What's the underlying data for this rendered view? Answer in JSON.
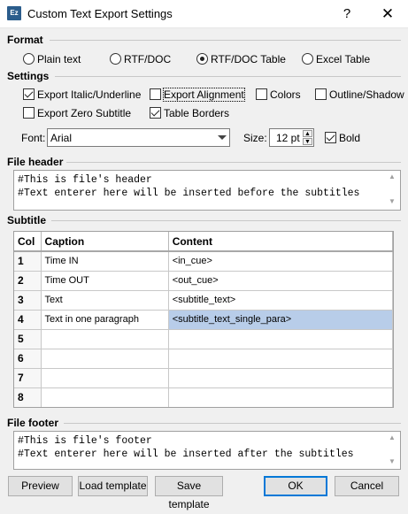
{
  "window": {
    "icon_text": "Ez",
    "title": "Custom Text Export Settings",
    "help_symbol": "?",
    "close_symbol": "✕"
  },
  "format": {
    "label": "Format",
    "options": [
      "Plain text",
      "RTF/DOC",
      "RTF/DOC Table",
      "Excel Table"
    ],
    "selected": "RTF/DOC Table"
  },
  "settings": {
    "label": "Settings",
    "export_italic": {
      "label": "Export Italic/Underline",
      "checked": true
    },
    "export_alignment": {
      "label": "Export Alignment",
      "checked": false
    },
    "colors": {
      "label": "Colors",
      "checked": false
    },
    "outline_shadow": {
      "label": "Outline/Shadow",
      "checked": false
    },
    "export_zero": {
      "label": "Export Zero Subtitle",
      "checked": false
    },
    "table_borders": {
      "label": "Table Borders",
      "checked": true
    },
    "font_label": "Font:",
    "font_value": "Arial",
    "size_label": "Size:",
    "size_value": "12 pt",
    "bold": {
      "label": "Bold",
      "checked": true
    }
  },
  "file_header": {
    "label": "File header",
    "text": "#This is file's header\n#Text enterer here will be inserted before the subtitles"
  },
  "subtitle": {
    "label": "Subtitle",
    "columns": [
      "Col",
      "Caption",
      "Content"
    ],
    "rows": [
      {
        "col": "1",
        "caption": "Time IN",
        "content": "<in_cue>"
      },
      {
        "col": "2",
        "caption": "Time OUT",
        "content": "<out_cue>"
      },
      {
        "col": "3",
        "caption": "Text",
        "content": "<subtitle_text>"
      },
      {
        "col": "4",
        "caption": "Text in one paragraph",
        "content": "<subtitle_text_single_para>"
      },
      {
        "col": "5",
        "caption": "",
        "content": ""
      },
      {
        "col": "6",
        "caption": "",
        "content": ""
      },
      {
        "col": "7",
        "caption": "",
        "content": ""
      },
      {
        "col": "8",
        "caption": "",
        "content": ""
      }
    ],
    "selected_row": 3
  },
  "file_footer": {
    "label": "File footer",
    "text": "#This is file's footer\n#Text enterer here will be inserted after the subtitles"
  },
  "buttons": {
    "preview": "Preview",
    "load_template": "Load template",
    "save_template": "Save template",
    "ok": "OK",
    "cancel": "Cancel"
  },
  "colors": {
    "selection": "#b8cde9",
    "default_button_border": "#0078d7",
    "app_icon": "#2b5d8c"
  }
}
